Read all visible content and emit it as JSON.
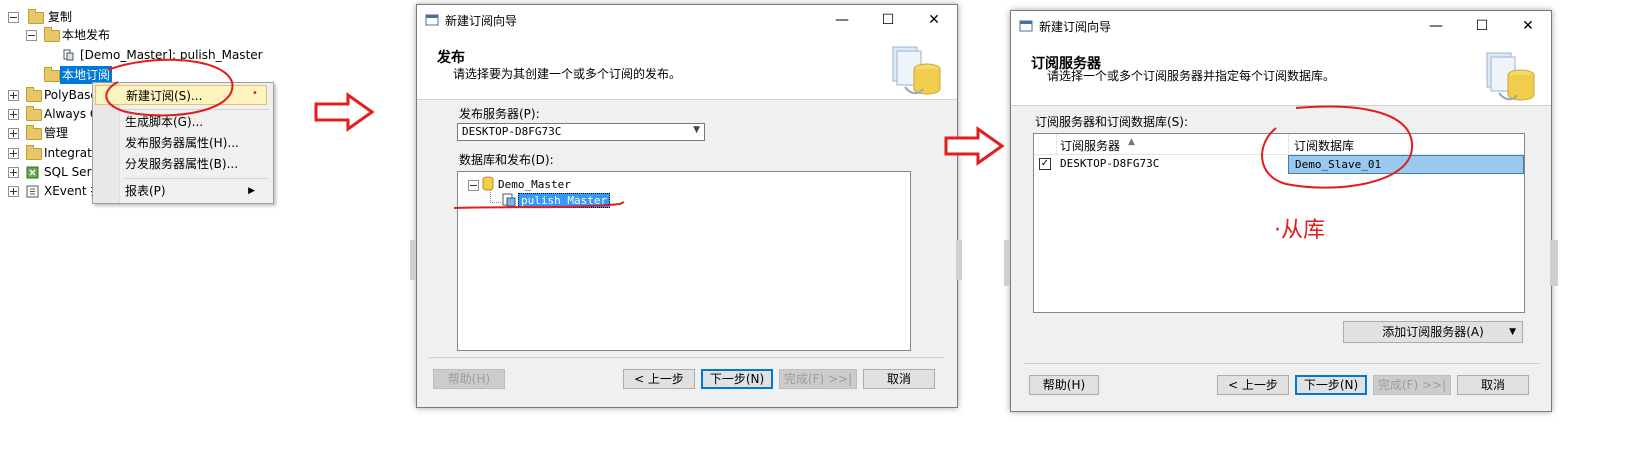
{
  "tree": {
    "replication": "复制",
    "local_publications": "本地发布",
    "publication_item": "[Demo_Master]: pulish_Master",
    "local_subscriptions": "本地订阅",
    "polybase": "PolyBase",
    "always_on": "Always O",
    "management": "管理",
    "integration": "Integratio",
    "sql_server": "SQL Serv",
    "xevent": "XEvent 排"
  },
  "context_menu": {
    "new_subscription": "新建订阅(S)...",
    "generate_scripts": "生成脚本(G)...",
    "publisher_props": "发布服务器属性(H)...",
    "distributor_props": "分发服务器属性(B)...",
    "reports": "报表(P)"
  },
  "dialog1": {
    "window_title": "新建订阅向导",
    "header_title": "发布",
    "header_subtitle": "请选择要为其创建一个或多个订阅的发布。",
    "publisher_label": "发布服务器(P):",
    "publisher_value": "DESKTOP-D8FG73C",
    "db_pub_label": "数据库和发布(D):",
    "db_node": "Demo_Master",
    "pub_node": "pulish_Master",
    "btn_help": "帮助(H)",
    "btn_back": "< 上一步",
    "btn_next": "下一步(N)",
    "btn_finish": "完成(F) >>|",
    "btn_cancel": "取消"
  },
  "dialog2": {
    "window_title": "新建订阅向导",
    "header_title": "订阅服务器",
    "header_subtitle": "请选择一个或多个订阅服务器并指定每个订阅数据库。",
    "grid_label": "订阅服务器和订阅数据库(S):",
    "col_server": "订阅服务器",
    "col_database": "订阅数据库",
    "rows": [
      {
        "checked": true,
        "server": "DESKTOP-D8FG73C",
        "database": "Demo_Slave_01"
      }
    ],
    "add_button": "添加订阅服务器(A)",
    "btn_help": "帮助(H)",
    "btn_back": "< 上一步",
    "btn_next": "下一步(N)",
    "btn_finish": "完成(F) >>|",
    "btn_cancel": "取消"
  },
  "annotation": {
    "slave_note": "从库"
  },
  "colors": {
    "selection": "#0078d7",
    "annotation_red": "#e01e1e",
    "menu_highlight": "#fdf4bf"
  }
}
